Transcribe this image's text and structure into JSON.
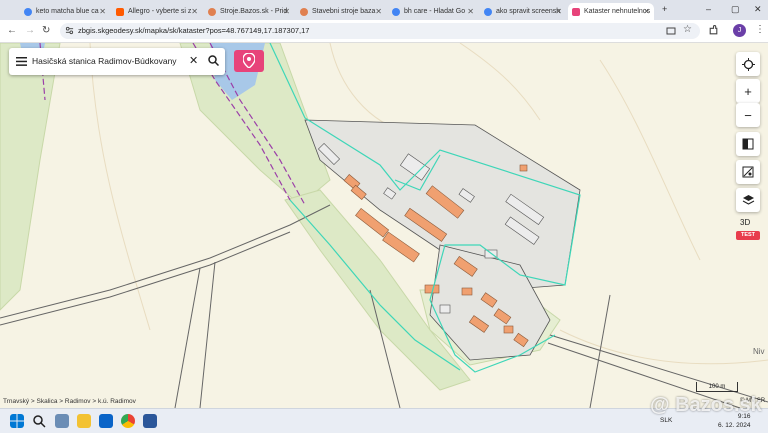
{
  "browser": {
    "tabs": [
      {
        "title": "keto matcha blue ca",
        "color": "#4285f4"
      },
      {
        "title": "Allegro - vyberte si z",
        "color": "#ff5a00"
      },
      {
        "title": "Stroje.Bazos.sk - Prid",
        "color": "#e08050"
      },
      {
        "title": "Stavebni stroje baza",
        "color": "#e08050"
      },
      {
        "title": "bh care - Hladat Go",
        "color": "#4285f4"
      },
      {
        "title": "ako spravit screensh",
        "color": "#4285f4"
      },
      {
        "title": "Kataster nehnutelnos",
        "color": "#e7437a"
      }
    ],
    "new_tab": "+",
    "window_buttons": [
      "–",
      "▢",
      "✕"
    ],
    "nav": {
      "back": "←",
      "forward": "→",
      "reload": "↻"
    },
    "url": "zbgis.skgeodesy.sk/mapka/sk/kataster?pos=48.767149,17.187307,17",
    "profile_initial": "J"
  },
  "map": {
    "search_text": "Hasičská stanica Radimov-Búdkovany",
    "breadcrumb": "Trnavský > Skalica > Radimov > k.ú. Radimov",
    "scale_label": "100 m",
    "attribution": "© MV SR",
    "place_label": "Niv",
    "controls": {
      "three_d": "3D",
      "test": "TEST"
    },
    "colors": {
      "parcel_outline": "#3ed6b8",
      "boundary": "#9b3fa8",
      "buildings": "#f0a070",
      "accent": "#e7437a"
    }
  },
  "taskbar": {
    "lang": "SLK",
    "time": "9:16",
    "date": "6. 12. 2024"
  },
  "watermark": "Bazos.sk"
}
